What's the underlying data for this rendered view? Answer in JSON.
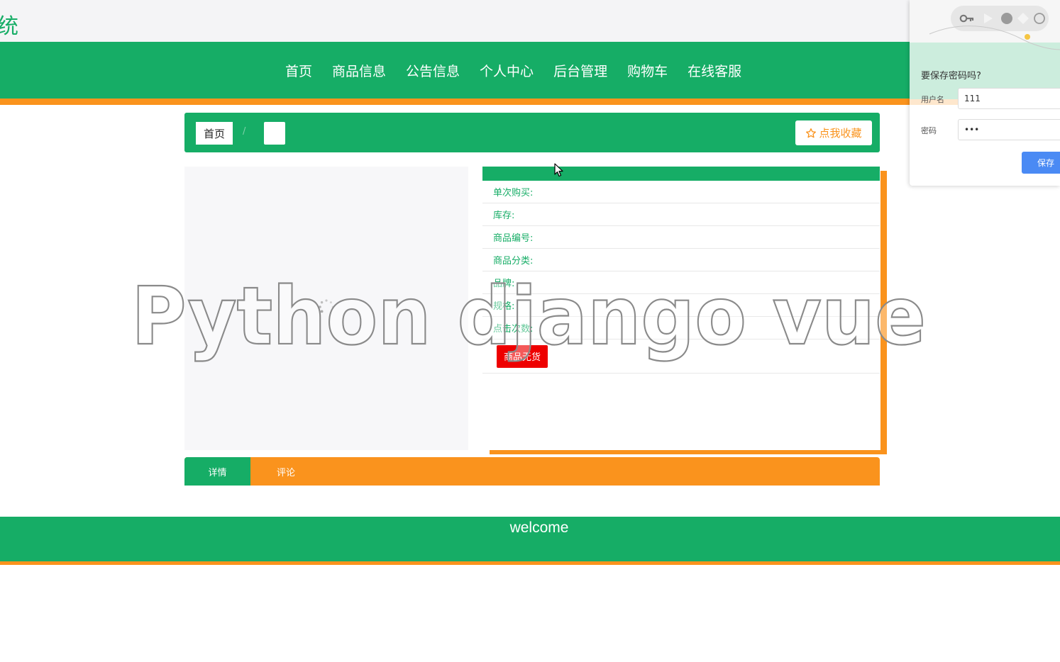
{
  "header": {
    "site_title_fragment": "统"
  },
  "nav": {
    "items": [
      {
        "label": "首页"
      },
      {
        "label": "商品信息"
      },
      {
        "label": "公告信息"
      },
      {
        "label": "个人中心"
      },
      {
        "label": "后台管理"
      },
      {
        "label": "购物车"
      },
      {
        "label": "在线客服"
      }
    ]
  },
  "breadcrumb": {
    "home": "首页",
    "separator": "/",
    "current": ""
  },
  "favorite_button": {
    "icon": "star-outline-icon",
    "label": "点我收藏"
  },
  "product": {
    "rows": [
      {
        "label": "单次购买:"
      },
      {
        "label": "库存:"
      },
      {
        "label": "商品编号:"
      },
      {
        "label": "商品分类:"
      },
      {
        "label": "品牌:"
      },
      {
        "label": "规格:"
      },
      {
        "label": "点击次数:"
      }
    ],
    "soldout_button": "商品无货"
  },
  "tabs": [
    {
      "label": "详情",
      "active": true
    },
    {
      "label": "评论",
      "active": false
    }
  ],
  "footer": {
    "text": "welcome"
  },
  "watermark": {
    "text": "Python django vue"
  },
  "password_popup": {
    "title": "要保存密码吗?",
    "username_label": "用户名",
    "username_value": "111",
    "password_label": "密码",
    "password_value": "•••",
    "save_button": "保存"
  },
  "colors": {
    "primary_green": "#16ad66",
    "accent_orange": "#fa931d",
    "soldout_red": "#ee0000",
    "save_blue": "#4a8af4"
  }
}
